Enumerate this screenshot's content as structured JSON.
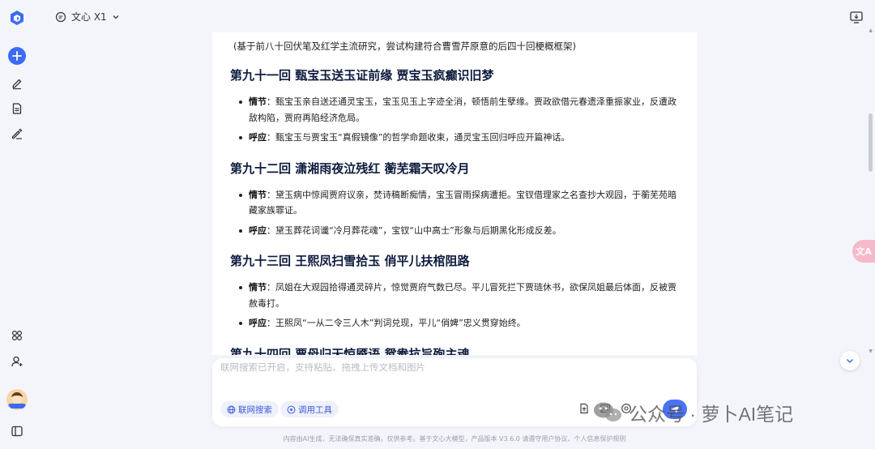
{
  "topbar": {
    "model_name": "文心 X1"
  },
  "document": {
    "intro": "(基于前八十回伏笔及红学主流研究，尝试构建符合曹雪芹原意的后四十回梗概框架)",
    "chapters": [
      {
        "title": "第九十一回 甄宝玉送玉证前缘 贾宝玉疯癫识旧梦",
        "items": [
          {
            "label": "情节",
            "text": "：甄宝玉亲自送还通灵宝玉，宝玉见玉上字迹全消，顿悟前生孽缘。贾政欲借元春遗泽重振家业，反遭政敌构陷，贾府再陷经济危局。"
          },
          {
            "label": "呼应",
            "text": "：甄宝玉与贾宝玉“真假镜像”的哲学命题收束，通灵宝玉回归呼应开篇神话。"
          }
        ]
      },
      {
        "title": "第九十二回 潇湘雨夜泣残红 蘅芜霜天叹冷月",
        "items": [
          {
            "label": "情节",
            "text": "：黛玉病中惊闻贾府议亲，焚诗稿断痴情，宝玉冒雨探病遭拒。宝钗借理家之名查抄大观园，于蘅芜苑暗藏家族罪证。"
          },
          {
            "label": "呼应",
            "text": "：黛玉葬花词谶“冷月葬花魂”，宝钗“山中高士”形象与后期黑化形成反差。"
          }
        ]
      },
      {
        "title": "第九十三回 王熙凤扫雪拾玉 俏平儿扶棺阻路",
        "items": [
          {
            "label": "情节",
            "text": "：凤姐在大观园拾得通灵碎片，惊觉贾府气数已尽。平儿冒死拦下贾琏休书，欲保凤姐最后体面，反被贾赦毒打。"
          },
          {
            "label": "呼应",
            "text": "：王熙凤“一从二令三人木”判词兑现，平儿“俏婢”忠义贯穿始终。"
          }
        ]
      },
      {
        "title": "第九十四回 贾母归天惊魇语 鸳鸯抗旨殉主魂",
        "items": []
      }
    ]
  },
  "input": {
    "placeholder": "联网搜索已开启，支持粘贴、拖拽上传文档和图片",
    "web_search_label": "联网搜索",
    "tools_label": "调用工具"
  },
  "floating": {
    "translate_label": "文A"
  },
  "watermark": {
    "text": "公众号 · 萝卜AI笔记"
  },
  "footer": {
    "disclaimer": "内容由AI生成，无法确保真实准确，仅供参考。基于文心大模型，产品版本 V3.6.0 请遵守用户协议、个人信息保护规则"
  },
  "colors": {
    "accent": "#3d6bf5",
    "title": "#0d1b3e",
    "background": "#f3f5fb"
  },
  "icons": [
    "logo-icon",
    "plus-icon",
    "edit-icon",
    "document-icon",
    "pen-icon",
    "apps-icon",
    "user-icon",
    "sidebar-toggle-icon",
    "chat-bubble-icon",
    "chevron-down-icon",
    "screen-icon",
    "globe-icon",
    "tool-icon",
    "upload-file-icon",
    "image-icon",
    "at-icon",
    "send-icon"
  ]
}
